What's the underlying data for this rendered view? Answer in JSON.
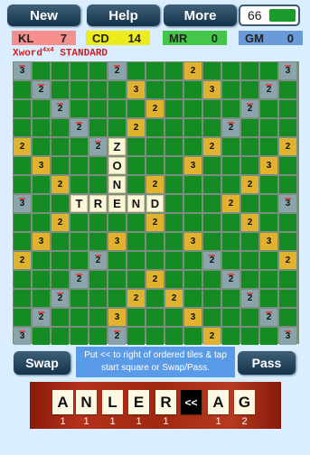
{
  "top_buttons": [
    {
      "id": "new",
      "label": "New"
    },
    {
      "id": "help",
      "label": "Help"
    },
    {
      "id": "more",
      "label": "More"
    }
  ],
  "turns": {
    "value": "66",
    "fill": 0.45
  },
  "scores": [
    {
      "name": "KL",
      "value": "7",
      "color": "#f6908f"
    },
    {
      "name": "CD",
      "value": "14",
      "color": "#ecec1c"
    },
    {
      "name": "MR",
      "value": "0",
      "color": "#45c64b"
    },
    {
      "name": "GM",
      "value": "0",
      "color": "#6a9bd8"
    }
  ],
  "subtitle": {
    "prefix": "Xword",
    "sup": "4x4",
    "suffix": " STANDARD"
  },
  "board": {
    "size": 15,
    "premium_rows": [
      [
        [
          0,
          "3",
          "gray"
        ],
        [
          5,
          "2",
          "gray"
        ],
        [
          9,
          "2",
          "gold"
        ],
        [
          14,
          "3",
          "gray"
        ]
      ],
      [
        [
          1,
          "2",
          "gray"
        ],
        [
          6,
          "3",
          "gold"
        ],
        [
          10,
          "3",
          "gold"
        ],
        [
          13,
          "2",
          "gray"
        ]
      ],
      [
        [
          2,
          "2",
          "gray"
        ],
        [
          7,
          "2",
          "gold"
        ],
        [
          12,
          "2",
          "gray"
        ]
      ],
      [
        [
          3,
          "2",
          "gray"
        ],
        [
          6,
          "2",
          "gold"
        ],
        [
          11,
          "2",
          "gray"
        ]
      ],
      [
        [
          0,
          "2",
          "gold"
        ],
        [
          4,
          "2",
          "gray"
        ],
        [
          10,
          "2",
          "gold"
        ],
        [
          14,
          "2",
          "gold"
        ]
      ],
      [
        [
          1,
          "3",
          "gold"
        ],
        [
          9,
          "3",
          "gold"
        ],
        [
          13,
          "3",
          "gold"
        ]
      ],
      [
        [
          2,
          "2",
          "gold"
        ],
        [
          7,
          "2",
          "gold"
        ],
        [
          12,
          "2",
          "gold"
        ]
      ],
      [
        [
          0,
          "3",
          "gray"
        ],
        [
          3,
          "2",
          "gold"
        ],
        [
          11,
          "2",
          "gold"
        ],
        [
          14,
          "3",
          "gray"
        ]
      ],
      [
        [
          2,
          "2",
          "gold"
        ],
        [
          7,
          "2",
          "gold"
        ],
        [
          12,
          "2",
          "gold"
        ]
      ],
      [
        [
          1,
          "3",
          "gold"
        ],
        [
          5,
          "3",
          "gold"
        ],
        [
          9,
          "3",
          "gold"
        ],
        [
          13,
          "3",
          "gold"
        ]
      ],
      [
        [
          0,
          "2",
          "gold"
        ],
        [
          4,
          "2",
          "gray"
        ],
        [
          10,
          "2",
          "gray"
        ],
        [
          14,
          "2",
          "gold"
        ]
      ],
      [
        [
          3,
          "2",
          "gray"
        ],
        [
          7,
          "2",
          "gold"
        ],
        [
          11,
          "2",
          "gray"
        ]
      ],
      [
        [
          2,
          "2",
          "gray"
        ],
        [
          6,
          "2",
          "gold"
        ],
        [
          8,
          "2",
          "gold"
        ],
        [
          12,
          "2",
          "gray"
        ]
      ],
      [
        [
          1,
          "2",
          "gray"
        ],
        [
          5,
          "3",
          "gold"
        ],
        [
          9,
          "3",
          "gold"
        ],
        [
          13,
          "2",
          "gray"
        ]
      ],
      [
        [
          0,
          "3",
          "gray"
        ],
        [
          5,
          "2",
          "gray"
        ],
        [
          10,
          "2",
          "gold"
        ],
        [
          14,
          "3",
          "gray"
        ]
      ]
    ],
    "placed_words": [
      {
        "word": "ZONE",
        "row": 4,
        "col": 5,
        "dir": "down"
      },
      {
        "word": "TREND",
        "row": 7,
        "col": 3,
        "dir": "across"
      }
    ]
  },
  "buttons": {
    "swap": "Swap",
    "pass": "Pass"
  },
  "hint": "Put << to right of ordered tiles & tap start square or Swap/Pass.",
  "rack": {
    "tiles": [
      {
        "letter": "A",
        "score": "1"
      },
      {
        "letter": "N",
        "score": "1"
      },
      {
        "letter": "L",
        "score": "1"
      },
      {
        "letter": "E",
        "score": "1"
      },
      {
        "letter": "R",
        "score": "1"
      },
      {
        "letter": "<<",
        "score": ""
      },
      {
        "letter": "A",
        "score": "1"
      },
      {
        "letter": "G",
        "score": "2"
      }
    ]
  },
  "colors": {
    "board_green": "#148c23",
    "premium_gold": "#e0b22d",
    "premium_gray": "#8aa4ab",
    "tile_cream": "#fbf6d7"
  }
}
